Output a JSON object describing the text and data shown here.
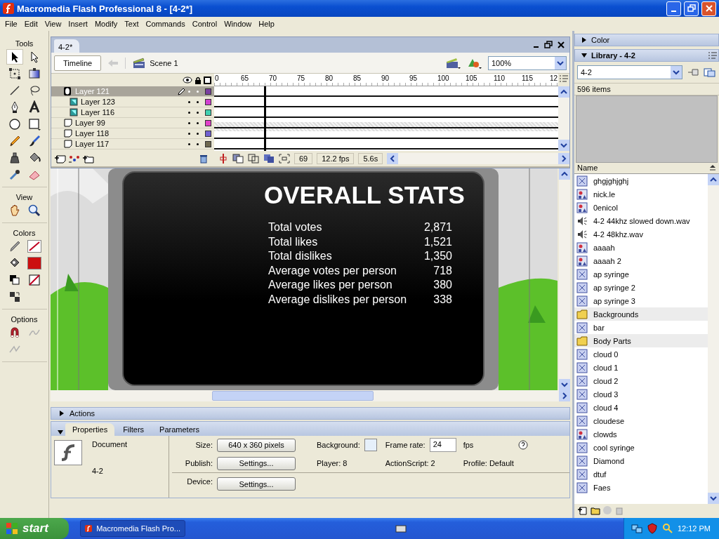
{
  "window": {
    "title": "Macromedia Flash Professional 8 - [4-2*]"
  },
  "menu": [
    "File",
    "Edit",
    "View",
    "Insert",
    "Modify",
    "Text",
    "Commands",
    "Control",
    "Window",
    "Help"
  ],
  "tools": [
    {
      "title": "Tools"
    },
    {
      "title": "View"
    },
    {
      "title": "Colors"
    },
    {
      "title": "Options"
    }
  ],
  "document": {
    "tabs": [
      {
        "label": "4-2*",
        "selected": true
      }
    ],
    "timeline_button": "Timeline",
    "scene": "Scene 1",
    "zoom": "100%"
  },
  "timeline": {
    "ruler": [
      "0",
      "65",
      "70",
      "75",
      "80",
      "85",
      "90",
      "95",
      "100",
      "105",
      "110",
      "115",
      "12"
    ],
    "layers": [
      {
        "name": "Layer 121",
        "kind": "mask",
        "selected": true,
        "color": "#7a3fa0",
        "children": [
          {
            "name": "Layer 123",
            "kind": "masked",
            "selected": false,
            "color": "#d040d0"
          },
          {
            "name": "Layer 116",
            "kind": "masked",
            "selected": false,
            "color": "#40d0b0"
          }
        ]
      },
      {
        "name": "Layer 99",
        "kind": "normal",
        "selected": false,
        "color": "#e040c8"
      },
      {
        "name": "Layer 118",
        "kind": "normal",
        "selected": false,
        "color": "#7060d0"
      },
      {
        "name": "Layer 117",
        "kind": "normal",
        "selected": false,
        "color": "#6e6850"
      }
    ],
    "frame": "69",
    "fps": "12.2 fps",
    "time": "5.6s"
  },
  "stage": {
    "title": "OVERALL STATS",
    "stats": [
      {
        "label": "Total votes",
        "value": "2,871"
      },
      {
        "label": "Total likes",
        "value": "1,521"
      },
      {
        "label": "Total dislikes",
        "value": "1,350"
      },
      {
        "label": "Average votes per person",
        "value": "718"
      },
      {
        "label": "Average likes per person",
        "value": "380"
      },
      {
        "label": "Average dislikes per person",
        "value": "338"
      }
    ]
  },
  "actions": {
    "title": "Actions",
    "expanded": false
  },
  "properties": {
    "expanded": true,
    "tabs": [
      {
        "label": "Properties",
        "selected": true
      },
      {
        "label": "Filters",
        "selected": false
      },
      {
        "label": "Parameters",
        "selected": false
      }
    ],
    "doc_type": "Document",
    "doc_name": "4-2",
    "size_label": "Size:",
    "size": "640 x 360 pixels",
    "background_label": "Background:",
    "frame_rate_label": "Frame rate:",
    "frame_rate": "24",
    "fps_unit": "fps",
    "publish_label": "Publish:",
    "publish_button": "Settings...",
    "player": "Player: 8",
    "actionscript": "ActionScript: 2",
    "profile": "Profile: Default",
    "device_label": "Device:",
    "device_button": "Settings..."
  },
  "color_panel": {
    "title": "Color",
    "expanded": false
  },
  "library": {
    "title": "Library - 4-2",
    "expanded": true,
    "document": "4-2",
    "count": "596 items",
    "column": "Name",
    "items": [
      {
        "name": "ghgjghjghj",
        "kind": "movieclip"
      },
      {
        "name": "nick.le",
        "kind": "graphic"
      },
      {
        "name": "0enicol",
        "kind": "graphic"
      },
      {
        "name": "4-2 44khz slowed down.wav",
        "kind": "sound"
      },
      {
        "name": "4-2 48khz.wav",
        "kind": "sound"
      },
      {
        "name": "aaaah",
        "kind": "graphic"
      },
      {
        "name": "aaaah 2",
        "kind": "graphic"
      },
      {
        "name": "ap syringe",
        "kind": "movieclip"
      },
      {
        "name": "ap syringe 2",
        "kind": "movieclip"
      },
      {
        "name": "ap syringe 3",
        "kind": "movieclip"
      },
      {
        "name": "Backgrounds",
        "kind": "folder"
      },
      {
        "name": "bar",
        "kind": "movieclip"
      },
      {
        "name": "Body Parts",
        "kind": "folder"
      },
      {
        "name": "cloud 0",
        "kind": "movieclip"
      },
      {
        "name": "cloud 1",
        "kind": "movieclip"
      },
      {
        "name": "cloud 2",
        "kind": "movieclip"
      },
      {
        "name": "cloud 3",
        "kind": "movieclip"
      },
      {
        "name": "cloud 4",
        "kind": "movieclip"
      },
      {
        "name": "cloudese",
        "kind": "movieclip"
      },
      {
        "name": "clowds",
        "kind": "graphic"
      },
      {
        "name": "cool syringe",
        "kind": "movieclip"
      },
      {
        "name": "Diamond",
        "kind": "movieclip"
      },
      {
        "name": "dtuf",
        "kind": "movieclip"
      },
      {
        "name": "Faes",
        "kind": "movieclip"
      }
    ]
  },
  "taskbar": {
    "start": "start",
    "tasks": [
      {
        "label": "Macromedia Flash Pro...",
        "selected": true
      }
    ],
    "clock": "12:12 PM"
  }
}
